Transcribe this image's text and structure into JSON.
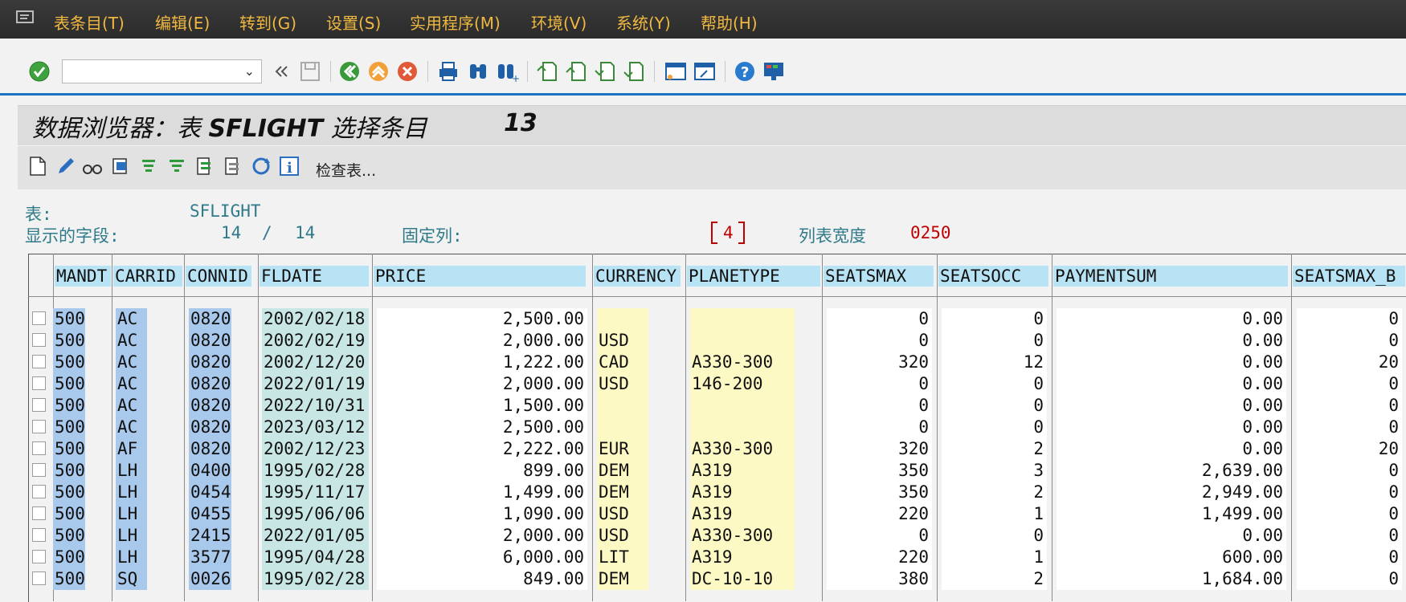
{
  "menu": {
    "items": [
      "表条目(T)",
      "编辑(E)",
      "转到(G)",
      "设置(S)",
      "实用程序(M)",
      "环境(V)",
      "系统(Y)",
      "帮助(H)"
    ]
  },
  "toolbar": {
    "command_value": "",
    "icons": [
      "enter-icon",
      "back-icon",
      "exit-icon",
      "cancel-icon",
      "print-icon",
      "find-icon",
      "find-next-icon",
      "first-page-icon",
      "prev-page-icon",
      "next-page-icon",
      "last-page-icon",
      "new-session-icon",
      "shortcut-icon",
      "help-icon",
      "customize-icon"
    ]
  },
  "title": {
    "prefix": "数据浏览器：表 ",
    "table": "SFLIGHT",
    "suffix": " 选择条目",
    "count": "13"
  },
  "app_toolbar": {
    "check_table_label": "检查表..."
  },
  "info": {
    "table_label": "表:",
    "table_value": "SFLIGHT",
    "fields_label": "显示的字段:",
    "fields_shown": "14",
    "fields_sep": "/",
    "fields_total": "14",
    "fixed_cols_label": "固定列:",
    "fixed_cols_value": "4",
    "list_width_label": "列表宽度",
    "list_width_value": "0250"
  },
  "colors": {
    "key_col_bg": "#a9c9ec",
    "fldate_bg": "#c8e6e3",
    "yellow_bg": "#fdf9c4",
    "header_bg": "#b7e3f4",
    "white_bg": "#ffffff"
  },
  "table": {
    "columns": [
      "MANDT",
      "CARRID",
      "CONNID",
      "FLDATE",
      "PRICE",
      "CURRENCY",
      "PLANETYPE",
      "SEATSMAX",
      "SEATSOCC",
      "PAYMENTSUM",
      "SEATSMAX_B"
    ],
    "rows": [
      [
        "500",
        "AC",
        "0820",
        "2002/02/18",
        "2,500.00",
        "",
        "",
        "0",
        "0",
        "0.00",
        "0"
      ],
      [
        "500",
        "AC",
        "0820",
        "2002/02/19",
        "2,000.00",
        "USD",
        "",
        "0",
        "0",
        "0.00",
        "0"
      ],
      [
        "500",
        "AC",
        "0820",
        "2002/12/20",
        "1,222.00",
        "CAD",
        "A330-300",
        "320",
        "12",
        "0.00",
        "20"
      ],
      [
        "500",
        "AC",
        "0820",
        "2022/01/19",
        "2,000.00",
        "USD",
        "146-200",
        "0",
        "0",
        "0.00",
        "0"
      ],
      [
        "500",
        "AC",
        "0820",
        "2022/10/31",
        "1,500.00",
        "",
        "",
        "0",
        "0",
        "0.00",
        "0"
      ],
      [
        "500",
        "AC",
        "0820",
        "2023/03/12",
        "2,500.00",
        "",
        "",
        "0",
        "0",
        "0.00",
        "0"
      ],
      [
        "500",
        "AF",
        "0820",
        "2002/12/23",
        "2,222.00",
        "EUR",
        "A330-300",
        "320",
        "2",
        "0.00",
        "20"
      ],
      [
        "500",
        "LH",
        "0400",
        "1995/02/28",
        "899.00",
        "DEM",
        "A319",
        "350",
        "3",
        "2,639.00",
        "0"
      ],
      [
        "500",
        "LH",
        "0454",
        "1995/11/17",
        "1,499.00",
        "DEM",
        "A319",
        "350",
        "2",
        "2,949.00",
        "0"
      ],
      [
        "500",
        "LH",
        "0455",
        "1995/06/06",
        "1,090.00",
        "USD",
        "A319",
        "220",
        "1",
        "1,499.00",
        "0"
      ],
      [
        "500",
        "LH",
        "2415",
        "2022/01/05",
        "2,000.00",
        "USD",
        "A330-300",
        "0",
        "0",
        "0.00",
        "0"
      ],
      [
        "500",
        "LH",
        "3577",
        "1995/04/28",
        "6,000.00",
        "LIT",
        "A319",
        "220",
        "1",
        "600.00",
        "0"
      ],
      [
        "500",
        "SQ",
        "0026",
        "1995/02/28",
        "849.00",
        "DEM",
        "DC-10-10",
        "380",
        "2",
        "1,684.00",
        "0"
      ]
    ]
  }
}
